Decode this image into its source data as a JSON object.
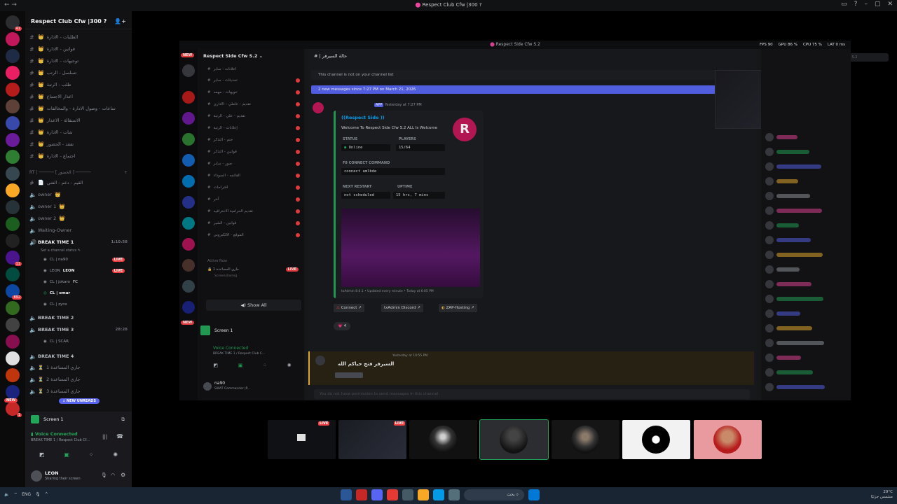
{
  "window": {
    "title": "Respect Club Cfw |300 ?",
    "controls": [
      "▭",
      "?",
      "–",
      "▢",
      "✕"
    ]
  },
  "server": {
    "name": "Respect Club Cfw |300 ?"
  },
  "rail_badges": [
    "41",
    "11",
    "892",
    "1"
  ],
  "channels": [
    {
      "name": "الطلبات - الادارة",
      "emoji": "👑"
    },
    {
      "name": "قوانين - الادارة",
      "emoji": "👑"
    },
    {
      "name": "توجيهات - الادارة",
      "emoji": "👑"
    },
    {
      "name": "تسلسل - الرتب",
      "emoji": "👑"
    },
    {
      "name": "طلب - الرتبة",
      "emoji": "👑"
    },
    {
      "name": "اعذار الاجتماع",
      "emoji": "👑"
    },
    {
      "name": "ساعات - وصول الادارة - والمخالفات",
      "emoji": "👑"
    },
    {
      "name": "الاستقالة - الاعذار",
      "emoji": "👑"
    },
    {
      "name": "شات - الادارة",
      "emoji": "👑"
    },
    {
      "name": "تفقد - الحضور",
      "emoji": "👑"
    },
    {
      "name": "اجتماع - الادارة",
      "emoji": "👑"
    }
  ],
  "category": "RT | ────── [ الحضور ] ──────",
  "voice_top": [
    {
      "name": "القيم - دعم - الفني",
      "emoji": "📄"
    },
    {
      "name": "owner",
      "emoji": "👑"
    },
    {
      "name": "owner 1",
      "emoji": "👑"
    },
    {
      "name": "owner 2",
      "emoji": "👑"
    },
    {
      "name": "Waiting-Owner",
      "emoji": ""
    }
  ],
  "break1": {
    "name": "BREAK TIME 1",
    "time": "1:10:58",
    "status": "Set a channel status ✎"
  },
  "break1_users": [
    {
      "name": "CL | na90",
      "live": "LIVE"
    },
    {
      "name": "LEON",
      "tag": "LEON",
      "live": "LIVE"
    },
    {
      "name": "CL | jokaro",
      "tag": "FC",
      "live": ""
    },
    {
      "name": "CL | omar",
      "live": ""
    },
    {
      "name": "CL | zyns",
      "live": ""
    }
  ],
  "break2": {
    "name": "BREAK TIME 2"
  },
  "break3": {
    "name": "BREAK TIME 3",
    "time": "28:28"
  },
  "break3_users": [
    {
      "name": "CL | SCAR"
    }
  ],
  "break4": {
    "name": "BREAK TIME 4"
  },
  "waiting_channels": [
    "جاري المساعدة 1",
    "جاري المساعدة 2",
    "جاري المساعدة 3"
  ],
  "new_unreads": "↓ NEW UNREADS",
  "new_label": "NEW",
  "screen_panel": {
    "title": "Screen 1"
  },
  "voice": {
    "status": "Voice Connected",
    "channel": "BREAK TIME 1 / Respect Club Cf..."
  },
  "user": {
    "name": "LEON",
    "status": "Sharing their screen"
  },
  "stream": {
    "window_title": "Respect Side Cfw S.2",
    "server_name": "Respect Side Cfw S.2",
    "channel_name": "حالة السيرفر",
    "fps": "FPS 90",
    "gpu": "GPU 86 %",
    "cpu": "CPU 75 %",
    "lat": "LAT 0 ms",
    "search_placeholder": "Search Respect Side Cfw S.2",
    "not_on_list": "This channel is not on your channel list",
    "new_messages": "2 new messages since 7:27 PM on March 21, 2026",
    "bot_tag": "APP",
    "bot_time": "Yesterday at 7:27 PM",
    "embed": {
      "title": "((Respect Side ))",
      "welcome": "Welcome To Respect Side Cfw S.2 ALL Is Welcome",
      "status_label": "STATUS",
      "status_value": "Online",
      "players_label": "PLAYERS",
      "players_value": "15/64",
      "f8_label": "F8 CONNECT COMMAND",
      "f8_value": "connect amlbde",
      "restart_label": "NEXT RESTART",
      "restart_value": "not scheduled",
      "uptime_label": "UPTIME",
      "uptime_value": "15 hrs, 7 mins",
      "footer": "txAdmin 8.0.1 • Updated every minute • Today at 6:05 PM"
    },
    "buttons": [
      "Connect",
      "txAdmin Discord",
      "ZAP-Hosting"
    ],
    "reaction": "4",
    "second_msg_text": "السيرفر فتح حياكم الله",
    "second_msg_time": "Yesterday at 10:55 PM",
    "no_permission": "You do not have permission to send messages in this channel.",
    "active_now": "Active Now",
    "active_item": "جاري المساعدة 1",
    "active_sub": "Screensharing",
    "show_all": "Show All",
    "screen_title": "Screen 1",
    "voice_status": "Voice Connected",
    "voice_channel": "BREAK TIME 1 / Respect Club C...",
    "user_name": "na90",
    "user_sub": "SWAT Commander |P...",
    "channels": [
      "اعلانات - ساير",
      "تحديثات - ساير",
      "تنويهات - مهمه",
      "تقديم - عاملي - الاداري",
      "تقديم - علي - الرتبة",
      "إعلانات - الرتبة",
      "ختم - التذكر",
      "قوانين - التذكر",
      "صور - ساير",
      "القائمه - السوداء",
      "اقتراحات",
      "آخر",
      "تقديم الحرامية الاحترافيه",
      "قوانين - الشير",
      "الموقع - الالكتروني"
    ]
  },
  "thumbnails": [
    {
      "live": ""
    },
    {
      "live": "LIVE"
    },
    {
      "live": "LIVE"
    },
    {
      "live": ""
    },
    {
      "live": ""
    },
    {
      "live": ""
    },
    {
      "live": ""
    },
    {
      "live": ""
    }
  ],
  "taskbar": {
    "lang": "ENG",
    "search": "بحث",
    "weather": "29°C",
    "weather_sub": "مشمس جزئيًا"
  },
  "colors": {
    "accent": "#5865f2",
    "live": "#f23f43",
    "online": "#23a559",
    "warning": "#f0b232"
  }
}
